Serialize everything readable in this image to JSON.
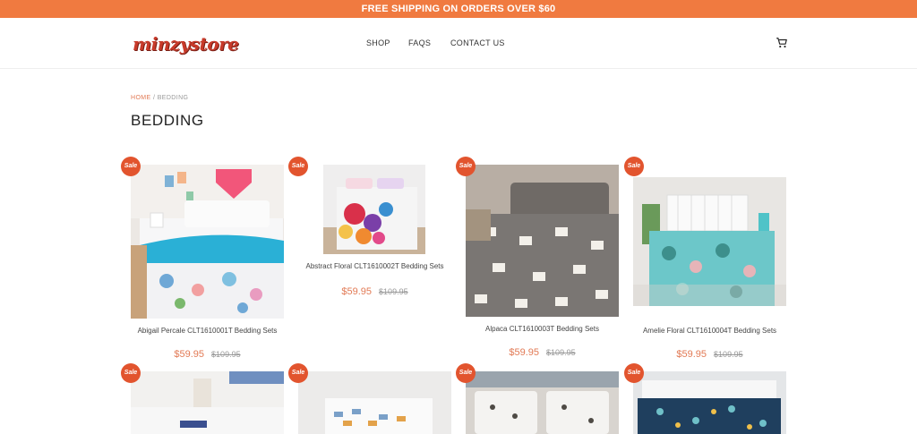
{
  "promo": {
    "text": "FREE SHIPPING ON ORDERS OVER $60"
  },
  "header": {
    "logo_text": "minzystore",
    "nav": {
      "shop": "SHOP",
      "faqs": "FAQS",
      "contact": "CONTACT US"
    },
    "cart_icon": "cart-icon"
  },
  "breadcrumb": {
    "home": "HOME",
    "separator": "/",
    "current": "BEDDING"
  },
  "page_title": "BEDDING",
  "colors": {
    "accent": "#f07a40",
    "sale_badge": "#e2542e",
    "price": "#e27a55"
  },
  "sale_label": "Sale",
  "products": [
    {
      "name": "Abigail Percale CLT1610001T Bedding Sets",
      "price": "$59.95",
      "old_price": "$109.95"
    },
    {
      "name": "Abstract Floral CLT1610002T Bedding Sets",
      "price": "$59.95",
      "old_price": "$109.95"
    },
    {
      "name": "Alpaca CLT1610003T Bedding Sets",
      "price": "$59.95",
      "old_price": "$109.95"
    },
    {
      "name": "Amelie Floral CLT1610004T Bedding Sets",
      "price": "$59.95",
      "old_price": "$109.95"
    }
  ]
}
